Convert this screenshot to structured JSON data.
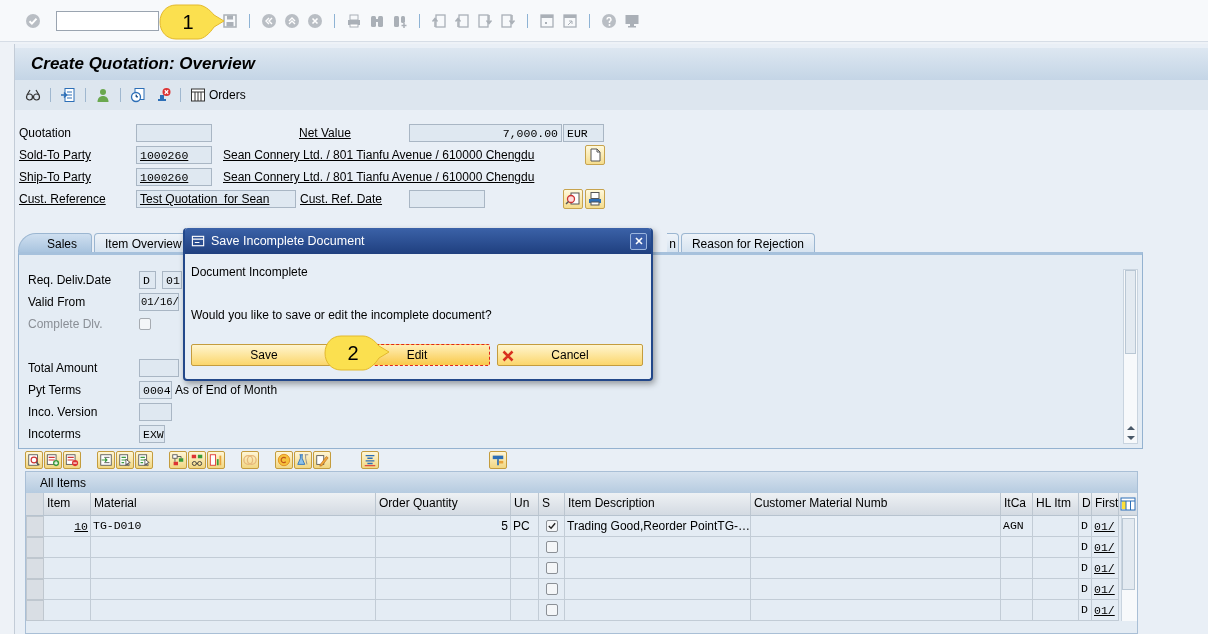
{
  "title": "Create Quotation: Overview",
  "app_toolbar": {
    "orders_button": "Orders"
  },
  "header": {
    "quotation_label": "Quotation",
    "net_value_label": "Net Value",
    "net_value": "7,000.00",
    "currency": "EUR",
    "sold_to_label": "Sold-To Party",
    "sold_to": "1000260",
    "sold_to_name": "Sean Connery Ltd. / 801 Tianfu Avenue / 610000 Chengdu",
    "ship_to_label": "Ship-To Party",
    "ship_to": "1000260",
    "ship_to_name": "Sean Connery Ltd. / 801 Tianfu Avenue / 610000 Chengdu",
    "cust_ref_label": "Cust. Reference",
    "cust_ref": "Test Quotation  for Sean",
    "cust_ref_date_label": "Cust. Ref. Date"
  },
  "tabs_left": [
    {
      "label": "Sales",
      "selected": true
    },
    {
      "label": "Item Overview",
      "selected": false
    }
  ],
  "tabs_right": [
    {
      "label": "n",
      "selected": false
    },
    {
      "label": "Reason for Rejection",
      "selected": false
    }
  ],
  "sales_panel": {
    "req_deliv_date_label": "Req. Deliv.Date",
    "req_deliv_date_type": "D",
    "req_deliv_date": "01",
    "valid_from_label": "Valid From",
    "valid_from": "01/16/",
    "complete_dlv": {
      "label": "Complete Dlv.",
      "checked": false,
      "disabled": true
    },
    "total_amount_label": "Total Amount",
    "pyt_terms_label": "Pyt Terms",
    "pyt_terms": "0004",
    "pyt_terms_text": "As of End of Month",
    "inco_version_label": "Inco. Version",
    "incoterms_label": "Incoterms",
    "incoterms": "EXW"
  },
  "table": {
    "title": "All Items",
    "columns": [
      "Item",
      "Material",
      "Order Quantity",
      "Un",
      "S",
      "Item Description",
      "Customer Material Numb",
      "ItCa",
      "HL Itm",
      "D",
      "First"
    ],
    "rows": [
      {
        "item": "10",
        "material": "TG-D010",
        "order_quantity": "5",
        "un": "PC",
        "checked": true,
        "item_description": "Trading Good,Reorder PointTG-…",
        "itca": "AGN",
        "d": "D",
        "first": "01/"
      },
      {
        "checked": false,
        "d": "D",
        "first": "01/"
      },
      {
        "checked": false,
        "d": "D",
        "first": "01/"
      },
      {
        "checked": false,
        "d": "D",
        "first": "01/"
      },
      {
        "checked": false,
        "d": "D",
        "first": "01/"
      }
    ]
  },
  "dialog": {
    "title": "Save Incomplete Document",
    "heading": "Document Incomplete",
    "message": "Would you like to save or edit the incomplete document?",
    "buttons": [
      {
        "label": "Save",
        "kind": "plain",
        "focused": false
      },
      {
        "label": "Edit",
        "kind": "plain",
        "focused": true
      },
      {
        "label": "Cancel",
        "kind": "cancel",
        "focused": false
      }
    ]
  },
  "callouts": [
    {
      "number": "1"
    },
    {
      "number": "2"
    }
  ]
}
